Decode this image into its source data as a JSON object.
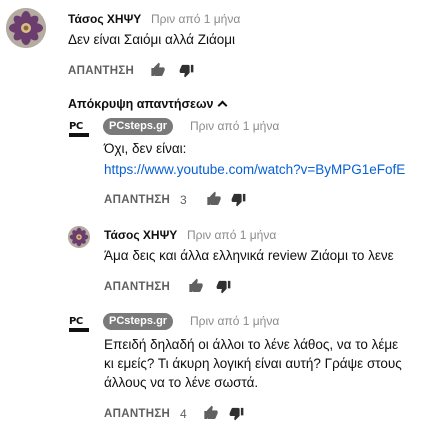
{
  "top_comment": {
    "author": "Τάσος ΧΗΨΥ",
    "time": "Πριν από 1 μήνα",
    "text": "Δεν είναι Σαιόμι αλλά Ζιάομι",
    "reply_label": "ΑΠΑΝΤΗΣΗ"
  },
  "replies_toggle": {
    "label": "Απόκρυψη απαντήσεων"
  },
  "replies": [
    {
      "author": "PCsteps.gr",
      "time": "Πριν από 1 μήνα",
      "text": "Όχι, δεν είναι:",
      "link": "https://www.youtube.com/watch?v=ByMPG1eFofE",
      "reply_label": "ΑΠΑΝΤΗΣΗ",
      "likes": "3"
    },
    {
      "author": "Τάσος ΧΗΨΥ",
      "time": "Πριν από 1 μήνα",
      "text": "Άμα δεις και άλλα ελληνικά review Ζιάομι το λενε",
      "reply_label": "ΑΠΑΝΤΗΣΗ"
    },
    {
      "author": "PCsteps.gr",
      "time": "Πριν από 1 μήνα",
      "text_lines": [
        "Επειδή δηλαδή οι άλλοι το λένε λάθος, να το λέμε",
        "κι εμείς? Τι άκυρη λογική είναι αυτή? Γράψε στους",
        "άλλους να το λένε σωστά."
      ],
      "reply_label": "ΑΠΑΝΤΗΣΗ",
      "likes": "4"
    }
  ],
  "pc_logo_text": "PC",
  "icons": {
    "avatar": "flower-avatar",
    "like": "thumbs-up-icon",
    "dislike": "thumbs-down-icon",
    "toggle": "chevron-up-icon"
  }
}
